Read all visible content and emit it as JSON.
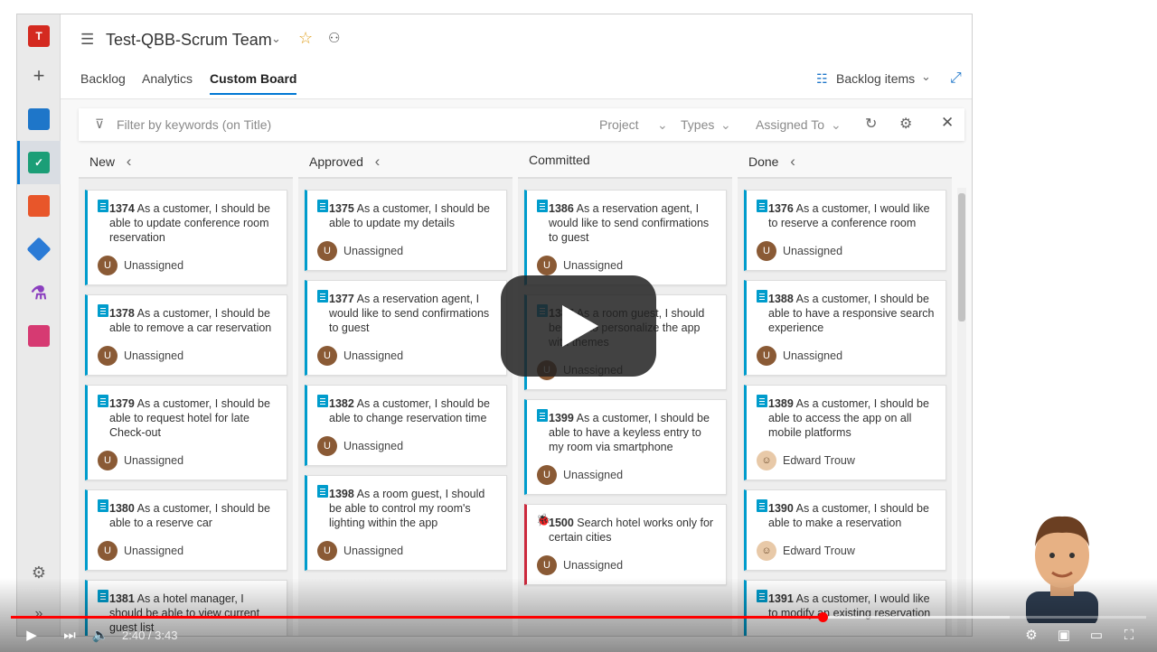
{
  "project": {
    "title": "Test-QBB-Scrum Team",
    "logo_letter": "T"
  },
  "tabs": [
    {
      "label": "Backlog"
    },
    {
      "label": "Analytics"
    },
    {
      "label": "Custom Board"
    }
  ],
  "backlog_selector": {
    "label": "Backlog items"
  },
  "filter": {
    "placeholder": "Filter by keywords (on Title)",
    "project": "Project",
    "types": "Types",
    "assigned_to": "Assigned To"
  },
  "columns": [
    {
      "title": "New",
      "cards": [
        {
          "id": "1374",
          "text": "As a customer, I should be able to update conference room reservation",
          "assignee": "Unassigned"
        },
        {
          "id": "1378",
          "text": "As a customer, I should be able to remove a car reservation",
          "assignee": "Unassigned"
        },
        {
          "id": "1379",
          "text": "As a customer, I should be able to request hotel for late Check-out",
          "assignee": "Unassigned"
        },
        {
          "id": "1380",
          "text": "As a customer, I should be able to a reserve car",
          "assignee": "Unassigned"
        },
        {
          "id": "1381",
          "text": "As a hotel manager, I should be able to view current guest list",
          "assignee": ""
        }
      ]
    },
    {
      "title": "Approved",
      "cards": [
        {
          "id": "1375",
          "text": "As a customer, I should be able to update my details",
          "assignee": "Unassigned"
        },
        {
          "id": "1377",
          "text": "As a reservation agent, I would like to send confirmations to guest",
          "assignee": "Unassigned"
        },
        {
          "id": "1382",
          "text": "As a customer, I should be able to change reservation time",
          "assignee": "Unassigned"
        },
        {
          "id": "1398",
          "text": "As a room guest, I should be able to control my room's lighting within the app",
          "assignee": "Unassigned"
        }
      ]
    },
    {
      "title": "Committed",
      "cards": [
        {
          "id": "1386",
          "text": "As a reservation agent, I would like to send confirmations to guest",
          "assignee": "Unassigned"
        },
        {
          "id": "1387",
          "text": "As a room guest, I should be able to personalize the app with themes",
          "assignee": "Unassigned"
        },
        {
          "id": "1399",
          "text": "As a customer, I should be able to have a keyless entry to my room via smartphone",
          "assignee": "Unassigned"
        },
        {
          "id": "1500",
          "text": "Search hotel works only for certain cities",
          "assignee": "Unassigned",
          "type": "bug"
        }
      ]
    },
    {
      "title": "Done",
      "cards": [
        {
          "id": "1376",
          "text": "As a customer, I would like to reserve a conference room",
          "assignee": "Unassigned"
        },
        {
          "id": "1388",
          "text": "As a customer, I should be able to have a responsive search experience",
          "assignee": "Unassigned"
        },
        {
          "id": "1389",
          "text": "As a customer, I should be able to access the app on all mobile platforms",
          "assignee": "Edward Trouw"
        },
        {
          "id": "1390",
          "text": "As a customer, I should be able to make a reservation",
          "assignee": "Edward Trouw"
        },
        {
          "id": "1391",
          "text": "As a customer, I would like to modify an existing reservation",
          "assignee": ""
        }
      ]
    }
  ],
  "avatar_letter": "U",
  "video": {
    "time": "2:40 / 3:43",
    "progress": 0.715,
    "buffered": 0.88
  },
  "colors": {
    "story": "#009ccc",
    "bug": "#cc293d",
    "accent": "#0078d4",
    "progress": "#ff0000"
  }
}
